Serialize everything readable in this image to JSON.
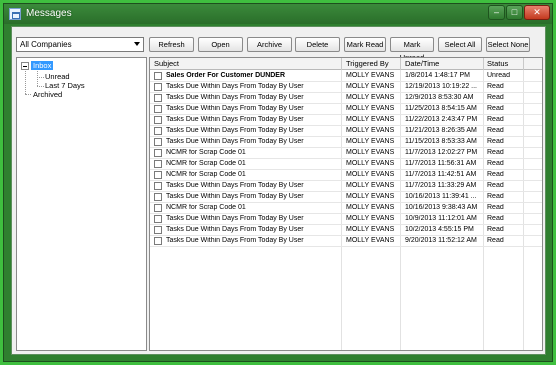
{
  "window": {
    "title": "Messages",
    "controls": {
      "minimize": "–",
      "maximize": "□",
      "close": "✕"
    }
  },
  "company_select": {
    "value": "All Companies"
  },
  "tree": {
    "root": "Inbox",
    "children": [
      "Unread",
      "Last 7 Days"
    ],
    "archived": "Archived"
  },
  "toolbar": {
    "refresh": "Refresh",
    "open": "Open",
    "archive": "Archive",
    "delete": "Delete",
    "mark_read": "Mark Read",
    "mark_unread": "Mark Unread",
    "select_all": "Select All",
    "select_none": "Select None"
  },
  "table": {
    "columns": [
      "Subject",
      "Triggered By",
      "Date/Time",
      "Status"
    ],
    "rows": [
      {
        "subject": "Sales Order For Customer DUNDER",
        "triggered_by": "MOLLY EVANS",
        "date_time": "1/8/2014 1:48:17 PM",
        "status": "Unread"
      },
      {
        "subject": "Tasks Due Within  Days From Today By User",
        "triggered_by": "MOLLY EVANS",
        "date_time": "12/19/2013 10:19:22 ...",
        "status": "Read"
      },
      {
        "subject": "Tasks Due Within  Days From Today By User",
        "triggered_by": "MOLLY EVANS",
        "date_time": "12/9/2013 8:53:30 AM",
        "status": "Read"
      },
      {
        "subject": "Tasks Due Within  Days From Today By User",
        "triggered_by": "MOLLY EVANS",
        "date_time": "11/25/2013 8:54:15 AM",
        "status": "Read"
      },
      {
        "subject": "Tasks Due Within  Days From Today By User",
        "triggered_by": "MOLLY EVANS",
        "date_time": "11/22/2013 2:43:47 PM",
        "status": "Read"
      },
      {
        "subject": "Tasks Due Within  Days From Today By User",
        "triggered_by": "MOLLY EVANS",
        "date_time": "11/21/2013 8:26:35 AM",
        "status": "Read"
      },
      {
        "subject": "Tasks Due Within  Days From Today By User",
        "triggered_by": "MOLLY EVANS",
        "date_time": "11/15/2013 8:53:33 AM",
        "status": "Read"
      },
      {
        "subject": "NCMR for Scrap Code 01",
        "triggered_by": "MOLLY EVANS",
        "date_time": "11/7/2013 12:02:27 PM",
        "status": "Read"
      },
      {
        "subject": "NCMR for Scrap Code 01",
        "triggered_by": "MOLLY EVANS",
        "date_time": "11/7/2013 11:56:31 AM",
        "status": "Read"
      },
      {
        "subject": "NCMR for Scrap Code 01",
        "triggered_by": "MOLLY EVANS",
        "date_time": "11/7/2013 11:42:51 AM",
        "status": "Read"
      },
      {
        "subject": "Tasks Due Within  Days From Today By User",
        "triggered_by": "MOLLY EVANS",
        "date_time": "11/7/2013 11:33:29 AM",
        "status": "Read"
      },
      {
        "subject": "Tasks Due Within  Days From Today By User",
        "triggered_by": "MOLLY EVANS",
        "date_time": "10/16/2013 11:39:41 ...",
        "status": "Read"
      },
      {
        "subject": "NCMR for Scrap Code 01",
        "triggered_by": "MOLLY EVANS",
        "date_time": "10/16/2013 9:38:43 AM",
        "status": "Read"
      },
      {
        "subject": "Tasks Due Within  Days From Today By User",
        "triggered_by": "MOLLY EVANS",
        "date_time": "10/9/2013 11:12:01 AM",
        "status": "Read"
      },
      {
        "subject": "Tasks Due Within  Days From Today By User",
        "triggered_by": "MOLLY EVANS",
        "date_time": "10/2/2013 4:55:15 PM",
        "status": "Read"
      },
      {
        "subject": "Tasks Due Within  Days From Today By User",
        "triggered_by": "MOLLY EVANS",
        "date_time": "9/20/2013 11:52:12 AM",
        "status": "Read"
      }
    ]
  }
}
